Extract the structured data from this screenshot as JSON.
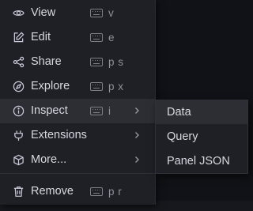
{
  "menu": {
    "items": [
      {
        "label": "View",
        "icon": "eye-icon",
        "shortcut": "v"
      },
      {
        "label": "Edit",
        "icon": "edit-icon",
        "shortcut": "e"
      },
      {
        "label": "Share",
        "icon": "share-icon",
        "shortcut": "p s"
      },
      {
        "label": "Explore",
        "icon": "compass-icon",
        "shortcut": "p x"
      },
      {
        "label": "Inspect",
        "icon": "info-circle-icon",
        "shortcut": "i",
        "has_submenu": true,
        "active": true
      },
      {
        "label": "Extensions",
        "icon": "plug-icon",
        "has_submenu": true
      },
      {
        "label": "More...",
        "icon": "cube-icon",
        "has_submenu": true
      },
      {
        "label": "Remove",
        "icon": "trash-icon",
        "shortcut": "p r"
      }
    ]
  },
  "submenu": {
    "items": [
      {
        "label": "Data",
        "active": true
      },
      {
        "label": "Query"
      },
      {
        "label": "Panel JSON"
      }
    ]
  },
  "colors": {
    "menu_background": "#1f2026",
    "active_background": "#2d2e34",
    "text": "#d8d9e0",
    "muted_text": "#8e8f98",
    "page_background": "#111217"
  }
}
